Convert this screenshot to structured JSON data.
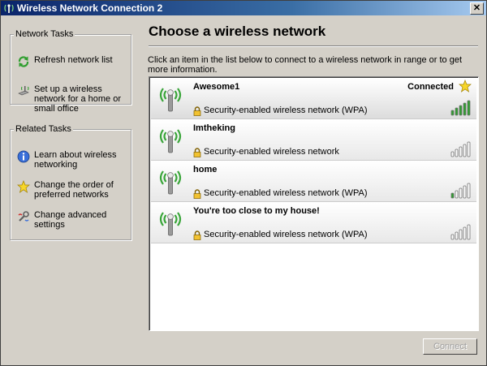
{
  "window": {
    "title": "Wireless Network Connection 2",
    "close_glyph": "✕"
  },
  "sidebar": {
    "network_tasks": {
      "title": "Network Tasks",
      "items": [
        {
          "label": "Refresh network list",
          "icon": "refresh-icon"
        },
        {
          "label": "Set up a wireless network for a home or small office",
          "icon": "setup-network-icon"
        }
      ]
    },
    "related_tasks": {
      "title": "Related Tasks",
      "items": [
        {
          "label": "Learn about wireless networking",
          "icon": "info-icon"
        },
        {
          "label": "Change the order of preferred networks",
          "icon": "star-icon"
        },
        {
          "label": "Change advanced settings",
          "icon": "settings-icon"
        }
      ]
    }
  },
  "main": {
    "heading": "Choose a wireless network",
    "instructions": "Click an item in the list below to connect to a wireless network in range or to get more information.",
    "networks": [
      {
        "name": "Awesome1",
        "status": "Connected",
        "security": "Security-enabled wireless network (WPA)",
        "signal_bars": 5,
        "favorite": true
      },
      {
        "name": "Imtheking",
        "status": "",
        "security": "Security-enabled wireless network",
        "signal_bars": 0,
        "favorite": false
      },
      {
        "name": "home",
        "status": "",
        "security": "Security-enabled wireless network (WPA)",
        "signal_bars": 1,
        "favorite": false
      },
      {
        "name": "You're too close to my house!",
        "status": "",
        "security": "Security-enabled wireless network (WPA)",
        "signal_bars": 0,
        "favorite": false
      }
    ],
    "connect_label": "Connect"
  },
  "colors": {
    "signal_on": "#2e9e2e",
    "signal_off": "#ffffff",
    "antenna_wave": "#3aa53a",
    "title_start": "#0a246a",
    "title_end": "#a6caf0"
  }
}
